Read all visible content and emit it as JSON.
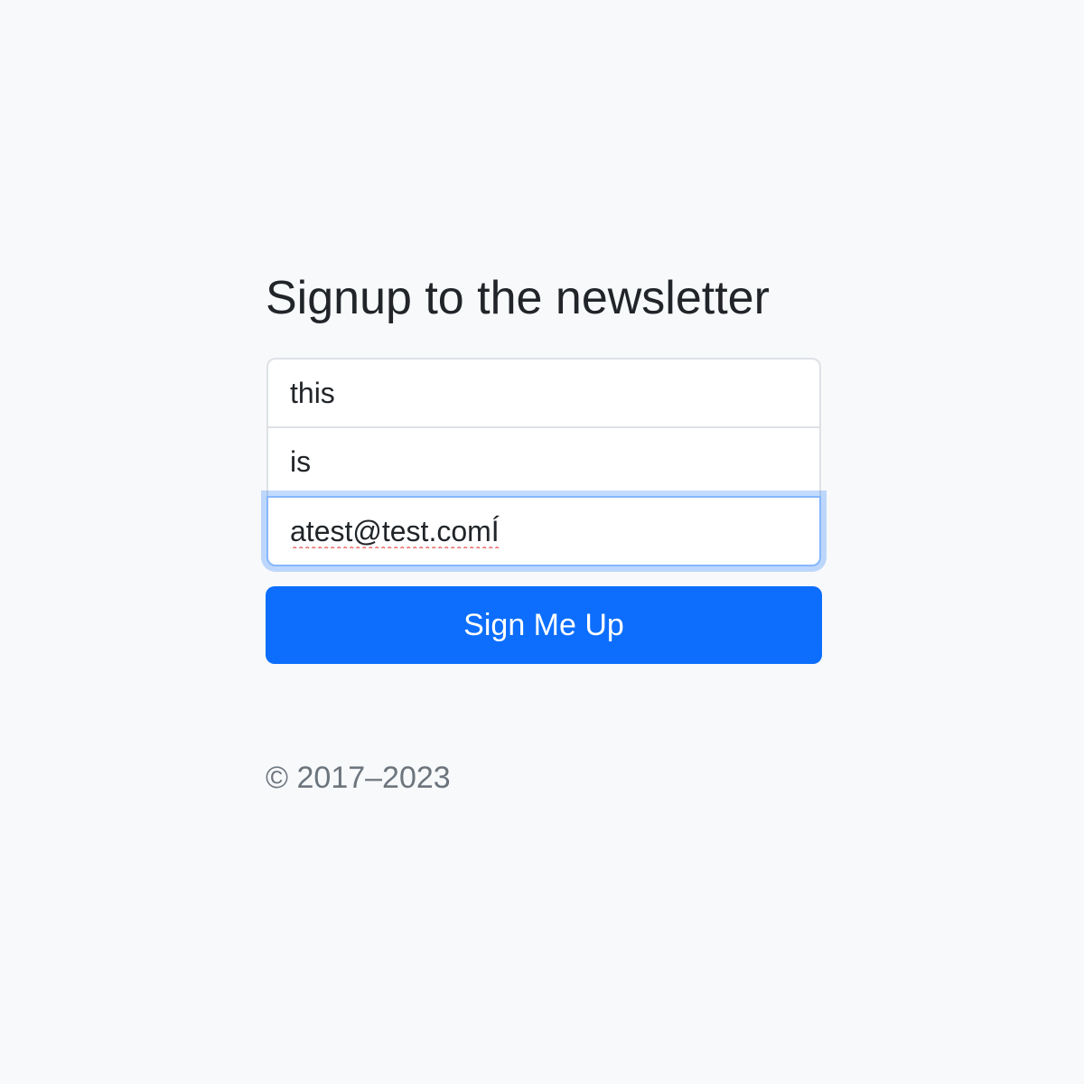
{
  "form": {
    "title": "Signup to the newsletter",
    "fields": [
      {
        "value": "this",
        "focused": false
      },
      {
        "value": "is",
        "focused": false
      },
      {
        "value": "atest@test.comÍ",
        "focused": true,
        "spellcheck_error": true
      }
    ],
    "submit_label": "Sign Me Up"
  },
  "footer": {
    "copyright": "© 2017–2023"
  },
  "colors": {
    "background": "#f8f9fb",
    "primary": "#0d6efd",
    "focus_ring": "#86b7fe",
    "text": "#212529",
    "muted": "#6c757d"
  }
}
